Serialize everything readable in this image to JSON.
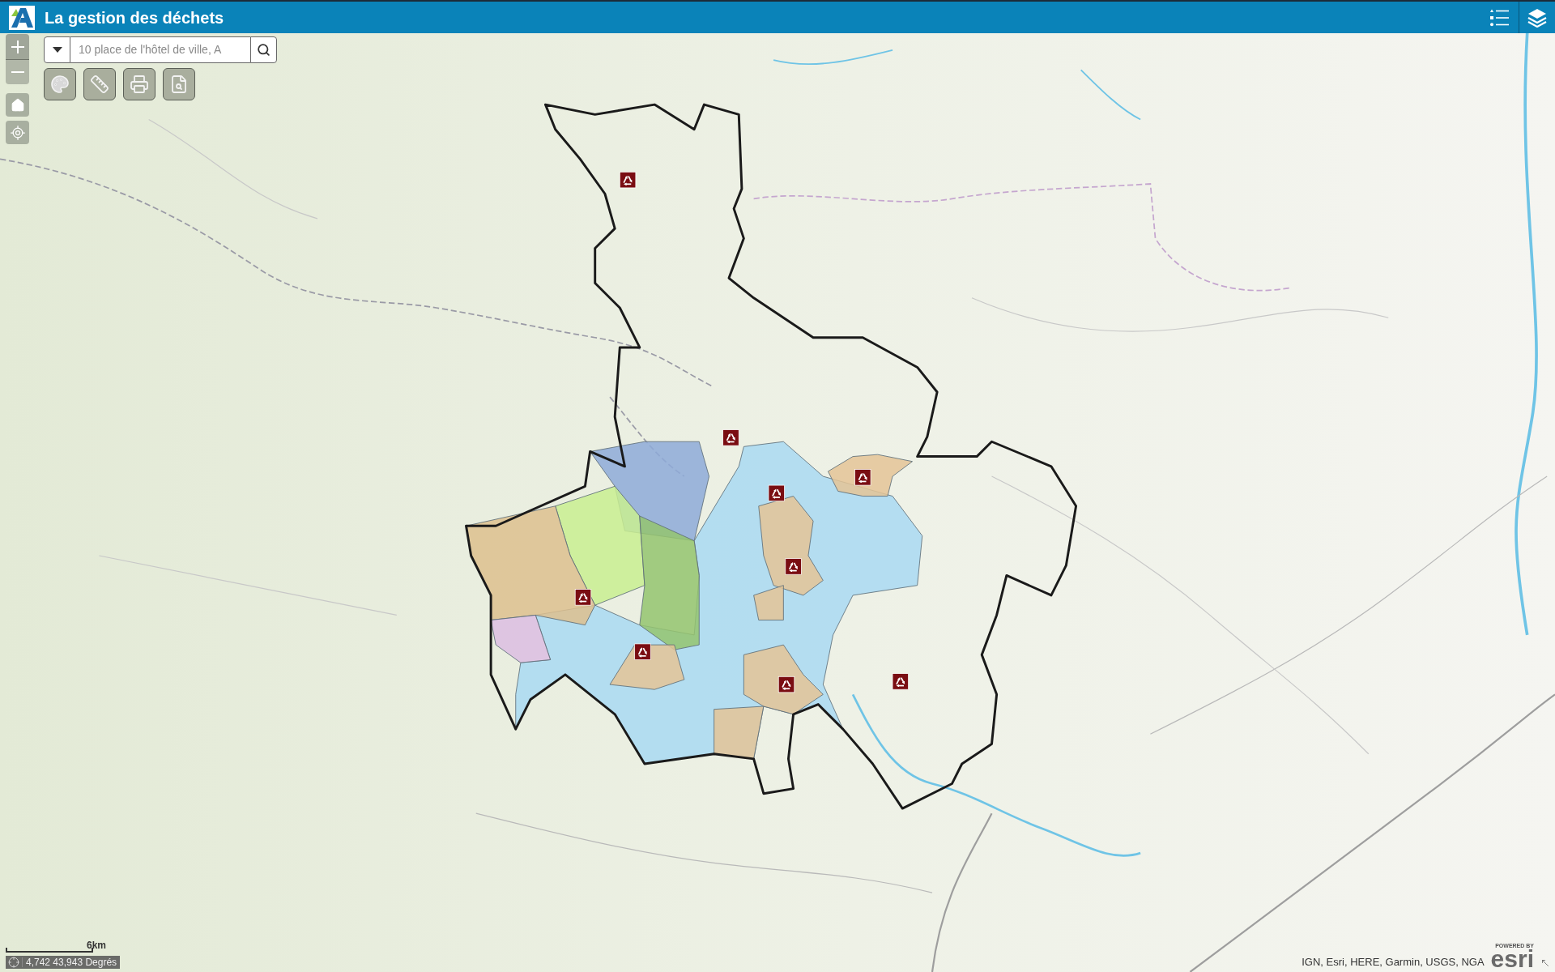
{
  "header": {
    "title": "La gestion des déchets"
  },
  "search": {
    "placeholder": "10 place de l'hôtel de ville, A"
  },
  "scale_bar": {
    "label": "6km"
  },
  "coordinates": {
    "text": "4,742 43,943 Degrés"
  },
  "attribution": "IGN, Esri, HERE, Garmin, USGS, NGA",
  "esri_logo": {
    "tagline": "POWERED BY",
    "wordmark": "esri"
  }
}
